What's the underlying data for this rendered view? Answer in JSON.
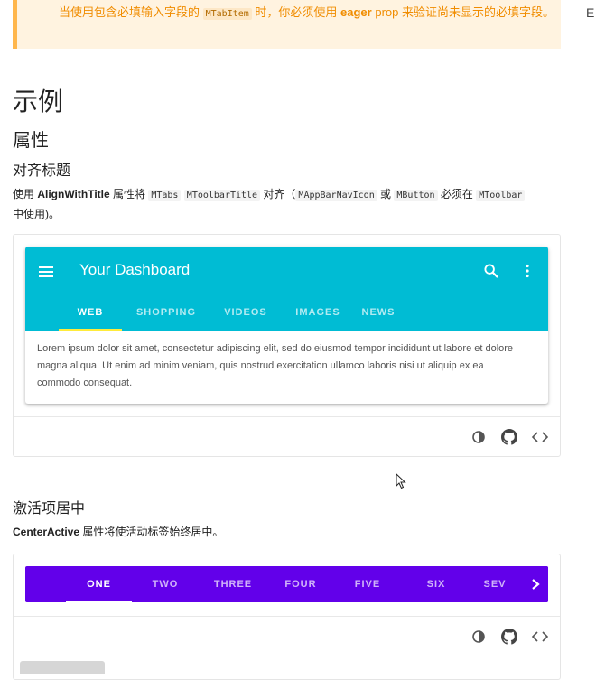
{
  "alert": {
    "text_before": "当使用包含必填输入字段的 ",
    "code": "MTabItem",
    "text_mid": " 时，你必须使用 ",
    "bold": "eager",
    "text_after": " prop 来验证尚未显示的必填字段。"
  },
  "right_edge_char": "E",
  "headings": {
    "examples": "示例",
    "props": "属性",
    "align_title": "对齐标题",
    "center_active": "激活项居中"
  },
  "align_desc": {
    "t1": "使用 ",
    "b1": "AlignWithTitle",
    "t2": " 属性将 ",
    "c1": "MTabs",
    "c2": "MToolbarTitle",
    "t3": " 对齐（",
    "c3": "MAppBarNavIcon",
    "t4": " 或 ",
    "c4": "MButton",
    "t5": " 必须在 ",
    "c5": "MToolbar",
    "t6": "中使用)。"
  },
  "dashboard": {
    "title": "Your Dashboard",
    "tabs": [
      "WEB",
      "SHOPPING",
      "VIDEOS",
      "IMAGES",
      "NEWS"
    ],
    "active_tab": "WEB",
    "body": "Lorem ipsum dolor sit amet, consectetur adipiscing elit, sed do eiusmod tempor incididunt ut labore et dolore magna aliqua. Ut enim ad minim veniam, quis nostrud exercitation ullamco laboris nisi ut aliquip ex ea commodo consequat.",
    "bar_color": "#00bcd4",
    "indicator_color": "#ffeb3b",
    "icons": [
      "menu-icon",
      "search-icon",
      "more-vert-icon"
    ]
  },
  "center_active_desc": {
    "b1": "CenterActive",
    "t1": " 属性将使活动标签始终居中。"
  },
  "center_tabs": {
    "tabs": [
      "ONE",
      "TWO",
      "THREE",
      "FOUR",
      "FIVE",
      "SIX",
      "SEV"
    ],
    "active_tab": "ONE",
    "bar_color": "#6200ea"
  },
  "footer_icons": [
    "invert-colors-icon",
    "github-icon",
    "code-icon"
  ]
}
